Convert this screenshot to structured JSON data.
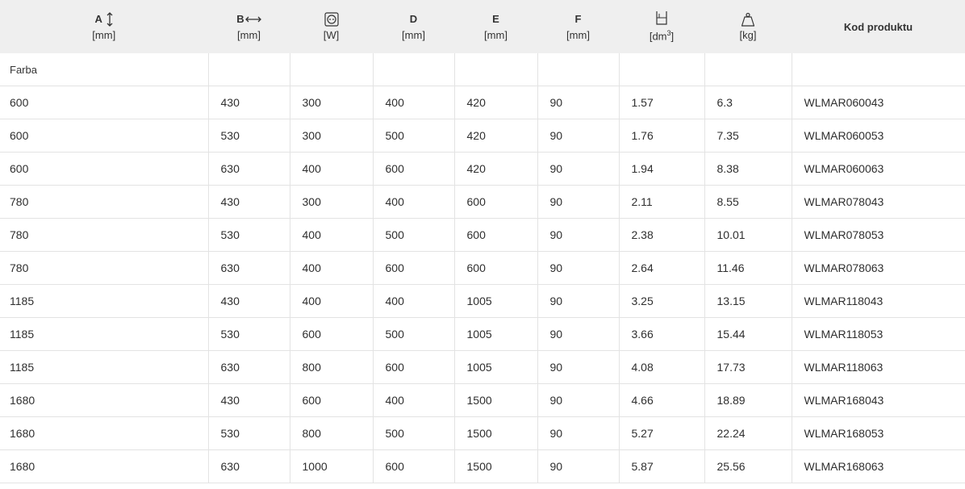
{
  "header": {
    "columns": [
      {
        "key": "a",
        "label": "A",
        "unit": "[mm]",
        "icon": "vertical-double-arrow-icon"
      },
      {
        "key": "b",
        "label": "B",
        "unit": "[mm]",
        "icon": "horizontal-double-arrow-icon"
      },
      {
        "key": "w",
        "label": "",
        "unit": "[W]",
        "icon": "socket-icon"
      },
      {
        "key": "d",
        "label": "D",
        "unit": "[mm]"
      },
      {
        "key": "e",
        "label": "E",
        "unit": "[mm]"
      },
      {
        "key": "f",
        "label": "F",
        "unit": "[mm]"
      },
      {
        "key": "v",
        "label": "",
        "unit_main": "[dm",
        "unit_sup": "3",
        "unit_end": "]",
        "icon": "container-volume-icon"
      },
      {
        "key": "kg",
        "label": "",
        "unit": "[kg]",
        "icon": "weight-icon"
      },
      {
        "key": "kod",
        "label": "Kod produktu"
      }
    ]
  },
  "group_label": "Farba",
  "rows": [
    {
      "a": "600",
      "b": "430",
      "w": "300",
      "d": "400",
      "e": "420",
      "f": "90",
      "v": "1.57",
      "kg": "6.3",
      "kod": "WLMAR060043"
    },
    {
      "a": "600",
      "b": "530",
      "w": "300",
      "d": "500",
      "e": "420",
      "f": "90",
      "v": "1.76",
      "kg": "7.35",
      "kod": "WLMAR060053"
    },
    {
      "a": "600",
      "b": "630",
      "w": "400",
      "d": "600",
      "e": "420",
      "f": "90",
      "v": "1.94",
      "kg": "8.38",
      "kod": "WLMAR060063"
    },
    {
      "a": "780",
      "b": "430",
      "w": "300",
      "d": "400",
      "e": "600",
      "f": "90",
      "v": "2.11",
      "kg": "8.55",
      "kod": "WLMAR078043"
    },
    {
      "a": "780",
      "b": "530",
      "w": "400",
      "d": "500",
      "e": "600",
      "f": "90",
      "v": "2.38",
      "kg": "10.01",
      "kod": "WLMAR078053"
    },
    {
      "a": "780",
      "b": "630",
      "w": "400",
      "d": "600",
      "e": "600",
      "f": "90",
      "v": "2.64",
      "kg": "11.46",
      "kod": "WLMAR078063"
    },
    {
      "a": "1185",
      "b": "430",
      "w": "400",
      "d": "400",
      "e": "1005",
      "f": "90",
      "v": "3.25",
      "kg": "13.15",
      "kod": "WLMAR118043"
    },
    {
      "a": "1185",
      "b": "530",
      "w": "600",
      "d": "500",
      "e": "1005",
      "f": "90",
      "v": "3.66",
      "kg": "15.44",
      "kod": "WLMAR118053"
    },
    {
      "a": "1185",
      "b": "630",
      "w": "800",
      "d": "600",
      "e": "1005",
      "f": "90",
      "v": "4.08",
      "kg": "17.73",
      "kod": "WLMAR118063"
    },
    {
      "a": "1680",
      "b": "430",
      "w": "600",
      "d": "400",
      "e": "1500",
      "f": "90",
      "v": "4.66",
      "kg": "18.89",
      "kod": "WLMAR168043"
    },
    {
      "a": "1680",
      "b": "530",
      "w": "800",
      "d": "500",
      "e": "1500",
      "f": "90",
      "v": "5.27",
      "kg": "22.24",
      "kod": "WLMAR168053"
    },
    {
      "a": "1680",
      "b": "630",
      "w": "1000",
      "d": "600",
      "e": "1500",
      "f": "90",
      "v": "5.87",
      "kg": "25.56",
      "kod": "WLMAR168063"
    }
  ]
}
